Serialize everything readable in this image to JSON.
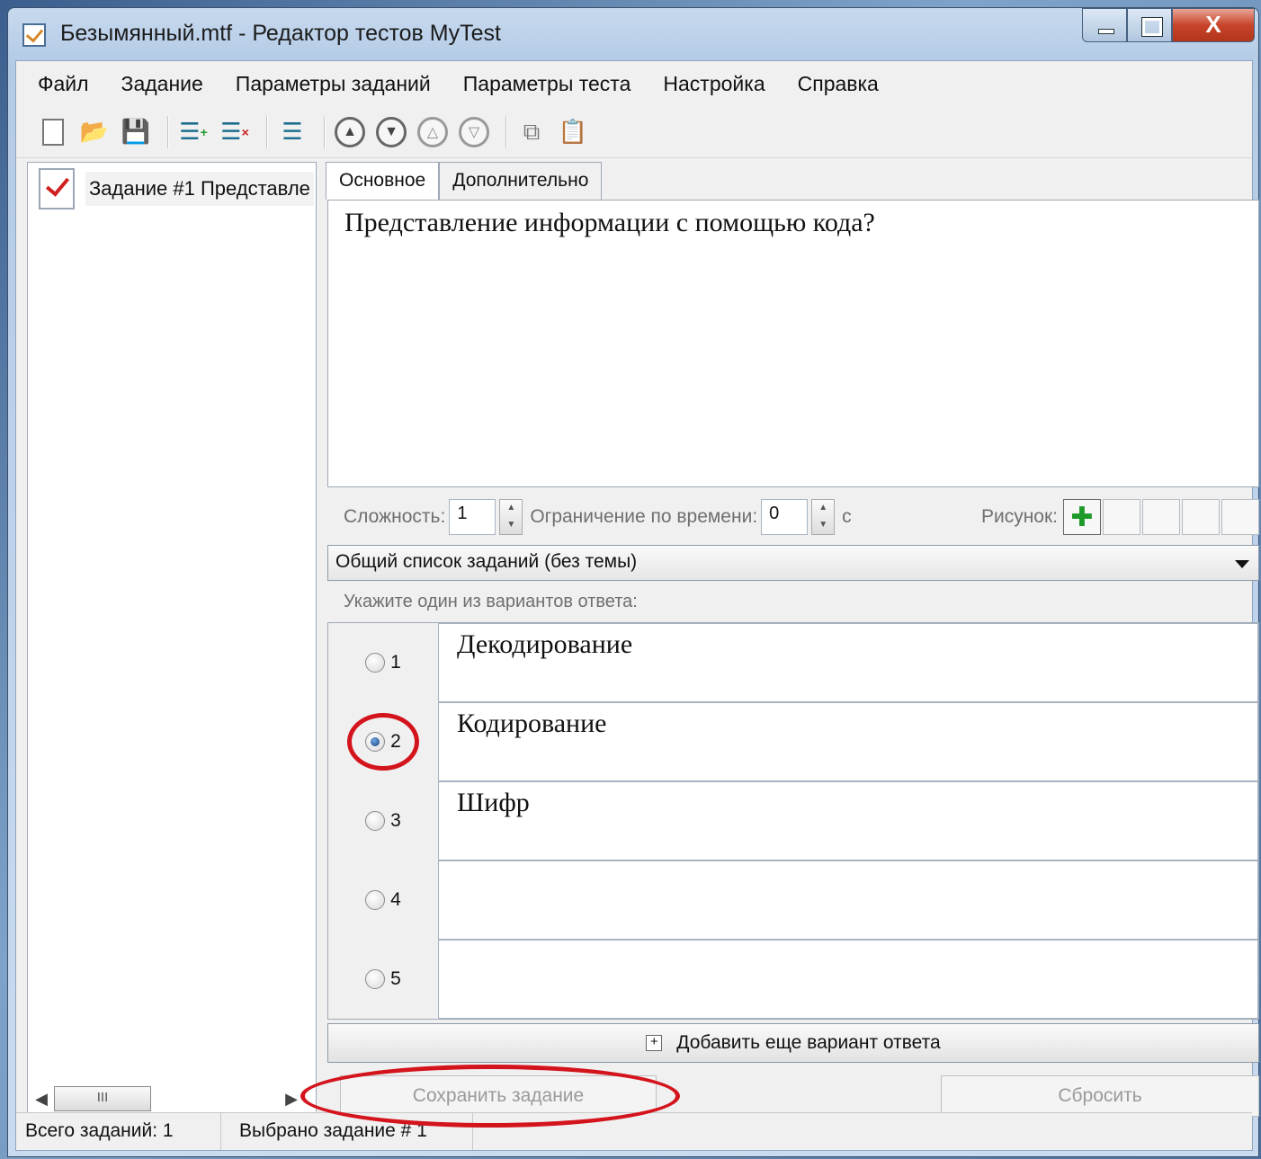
{
  "window": {
    "title": "Безымянный.mtf - Редактор тестов MyTest",
    "close_glyph": "X"
  },
  "menu": [
    "Файл",
    "Задание",
    "Параметры заданий",
    "Параметры теста",
    "Настройка",
    "Справка"
  ],
  "toolbar": {
    "icons": [
      "new-file-icon",
      "open-folder-icon",
      "save-icon",
      "add-task-icon",
      "delete-task-icon",
      "task-order-icon",
      "move-up-icon",
      "move-down-icon",
      "move-prev-icon",
      "move-next-icon",
      "copy-icon",
      "paste-icon"
    ]
  },
  "tree": {
    "item_label": "Задание #1 Представле",
    "scroll_thumb": "III"
  },
  "tabs": [
    "Основное",
    "Дополнительно"
  ],
  "question": {
    "text": "Представление информации с помощью кода?"
  },
  "params": {
    "difficulty_label": "Сложность:",
    "difficulty_value": "1",
    "time_label": "Ограничение по времени:",
    "time_value": "0",
    "time_unit": "с",
    "picture_label": "Рисунок:"
  },
  "topic": {
    "selected": "Общий список заданий (без темы)"
  },
  "prompt": "Укажите один из вариантов ответа:",
  "answers": [
    {
      "num": "1",
      "text": "Декодирование",
      "checked": false
    },
    {
      "num": "2",
      "text": "Кодирование",
      "checked": true
    },
    {
      "num": "3",
      "text": "Шифр",
      "checked": false
    },
    {
      "num": "4",
      "text": "",
      "checked": false
    },
    {
      "num": "5",
      "text": "",
      "checked": false
    }
  ],
  "buttons": {
    "add_answer": "Добавить еще вариант ответа",
    "save": "Сохранить задание",
    "reset": "Сбросить"
  },
  "status": {
    "total": "Всего заданий: 1",
    "selected": "Выбрано задание # 1"
  },
  "colors": {
    "highlight_ring": "#d4141c",
    "selected_radio": "#123c78"
  }
}
